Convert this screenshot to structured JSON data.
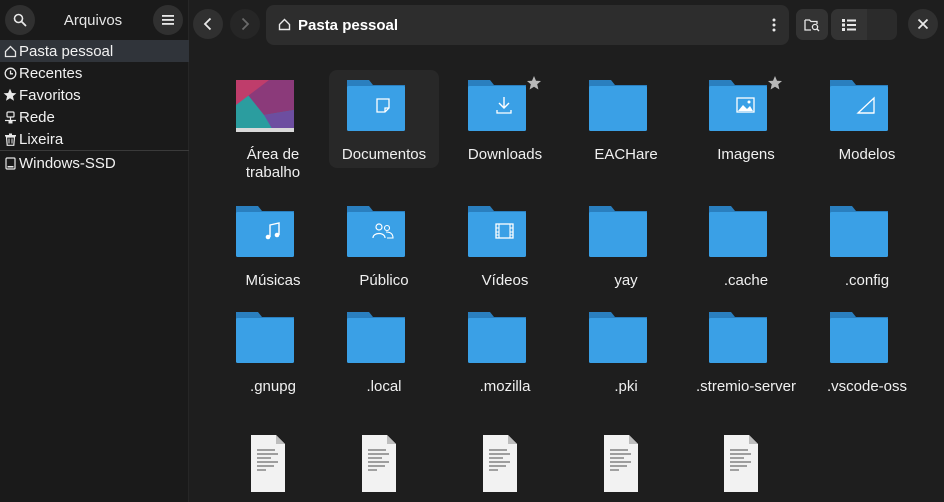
{
  "sidebar": {
    "title": "Arquivos",
    "items": [
      {
        "label": "Pasta pessoal",
        "icon": "home-icon",
        "active": true
      },
      {
        "label": "Recentes",
        "icon": "clock-icon"
      },
      {
        "label": "Favoritos",
        "icon": "star-icon"
      },
      {
        "label": "Rede",
        "icon": "network-icon"
      },
      {
        "label": "Lixeira",
        "icon": "trash-icon"
      }
    ],
    "devices": [
      {
        "label": "Windows-SSD",
        "icon": "drive-icon"
      }
    ]
  },
  "header": {
    "path_label": "Pasta pessoal"
  },
  "files": [
    {
      "label": "Área de trabalho",
      "kind": "desktop"
    },
    {
      "label": "Documentos",
      "kind": "folder",
      "emblem": "document",
      "selected": true
    },
    {
      "label": "Downloads",
      "kind": "folder",
      "emblem": "download",
      "starred": true
    },
    {
      "label": "EACHare",
      "kind": "folder"
    },
    {
      "label": "Imagens",
      "kind": "folder",
      "emblem": "image",
      "starred": true
    },
    {
      "label": "Modelos",
      "kind": "folder",
      "emblem": "template"
    },
    {
      "label": "Músicas",
      "kind": "folder",
      "emblem": "music"
    },
    {
      "label": "Público",
      "kind": "folder",
      "emblem": "people"
    },
    {
      "label": "Vídeos",
      "kind": "folder",
      "emblem": "video"
    },
    {
      "label": "yay",
      "kind": "folder"
    },
    {
      "label": ".cache",
      "kind": "folder"
    },
    {
      "label": ".config",
      "kind": "folder"
    },
    {
      "label": ".gnupg",
      "kind": "folder"
    },
    {
      "label": ".local",
      "kind": "folder"
    },
    {
      "label": ".mozilla",
      "kind": "folder"
    },
    {
      "label": ".pki",
      "kind": "folder"
    },
    {
      "label": ".stremio-server",
      "kind": "folder"
    },
    {
      "label": ".vscode-oss",
      "kind": "folder"
    },
    {
      "label": "",
      "kind": "textfile"
    },
    {
      "label": "",
      "kind": "textfile"
    },
    {
      "label": "",
      "kind": "textfile"
    },
    {
      "label": "",
      "kind": "textfile"
    },
    {
      "label": "",
      "kind": "textfile"
    }
  ],
  "colors": {
    "folder_body": "#3aa0e6",
    "folder_tab": "#2a7fbf",
    "accent_selected": "#30343a"
  }
}
